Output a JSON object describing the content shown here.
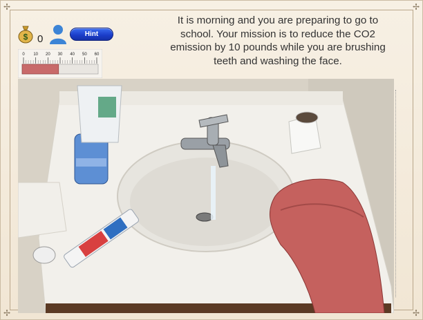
{
  "hud": {
    "money_count": "0",
    "hint_label": "Hint",
    "gauge_ticks": [
      "0",
      "10",
      "20",
      "30",
      "40",
      "50",
      "60"
    ],
    "gauge_level_fraction": 0.48,
    "money_icon_text": "$"
  },
  "mission": {
    "text": "It is morning and you are preparing to go to school. Your mission is to reduce the CO2 emission by 10 pounds while you are brushing teeth and washing the face."
  },
  "scene": {
    "description_items": [
      "soap-pump-bottle",
      "cream-tube",
      "faucet",
      "running-water",
      "toilet-paper-roll",
      "toothpaste-tube",
      "towel",
      "drain"
    ]
  },
  "colors": {
    "hint_button": "#1a3cc8",
    "gauge_fill": "#c86a6a",
    "towel": "#c5615e",
    "sink": "#f3f1ec"
  }
}
